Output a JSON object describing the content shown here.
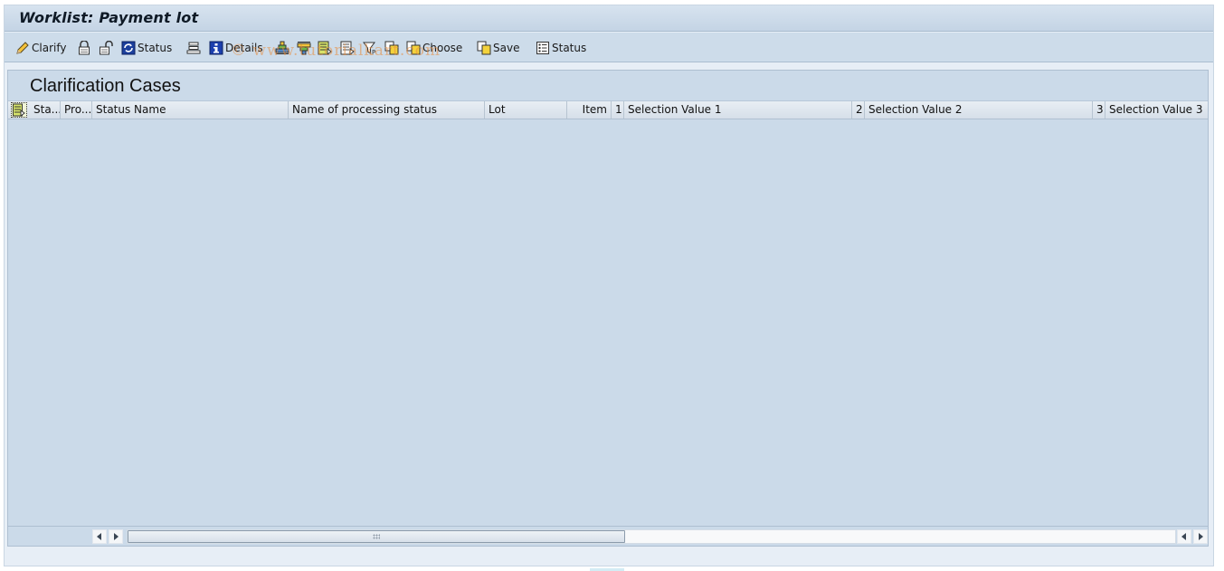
{
  "window": {
    "title": "Worklist: Payment lot"
  },
  "toolbar": {
    "items": [
      {
        "icon": "pencil-icon",
        "label": "Clarify"
      },
      {
        "icon": "lock-icon",
        "label": ""
      },
      {
        "icon": "unlock-icon",
        "label": ""
      },
      {
        "icon": "refresh-status-icon",
        "label": "Status"
      },
      {
        "icon": "layout-icon",
        "label": ""
      },
      {
        "icon": "info-icon",
        "label": "Details"
      },
      {
        "icon": "sort-ascending-icon",
        "label": ""
      },
      {
        "icon": "sort-descending-icon",
        "label": ""
      },
      {
        "icon": "change-layout-icon",
        "label": ""
      },
      {
        "icon": "select-layout-icon",
        "label": ""
      },
      {
        "icon": "filter-icon",
        "label": ""
      },
      {
        "icon": "copy-layout-icon",
        "label": ""
      },
      {
        "icon": "choose-icon",
        "label": "Choose"
      },
      {
        "icon": "save-layout-icon",
        "label": "Save"
      },
      {
        "icon": "status-list-icon",
        "label": "Status"
      }
    ]
  },
  "watermark": "© www.tutorialkart.com",
  "panel": {
    "title": "Clarification Cases"
  },
  "grid": {
    "columns": [
      {
        "label": "Sta..."
      },
      {
        "label": "Pro..."
      },
      {
        "label": "Status Name"
      },
      {
        "label": "Name of processing status"
      },
      {
        "label": "Lot"
      },
      {
        "label": "Item"
      },
      {
        "label": "1"
      },
      {
        "label": "Selection Value 1"
      },
      {
        "label": "2"
      },
      {
        "label": "Selection Value 2"
      },
      {
        "label": "3"
      },
      {
        "label": "Selection Value 3"
      }
    ],
    "rows": []
  },
  "colors": {
    "panel_bg": "#cbdae9",
    "toolbar_bg": "#cddcea",
    "title_text": "#0f1a26",
    "watermark": "#e88c3c"
  }
}
